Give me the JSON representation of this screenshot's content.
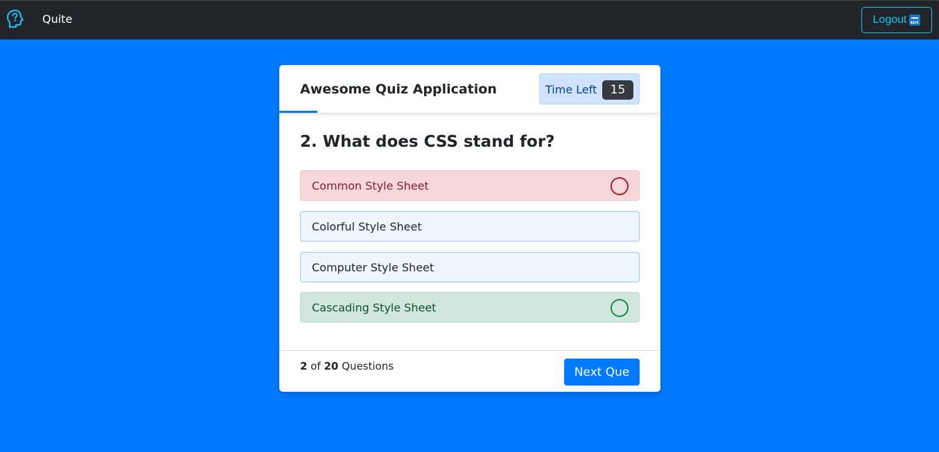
{
  "navbar": {
    "brand_icon": "head-question-icon",
    "brand_name": "Quite",
    "logout_label": "Logout",
    "logout_icon": "back-arrow-icon"
  },
  "quiz": {
    "title": "Awesome Quiz Application",
    "timer_label": "Time Left",
    "timer_value": "15",
    "progress": 0.1,
    "question": "2. What does CSS stand for?",
    "options": [
      {
        "label": "Common Style Sheet",
        "state": "wrong"
      },
      {
        "label": "Colorful Style Sheet",
        "state": "neutral"
      },
      {
        "label": "Computer Style Sheet",
        "state": "neutral"
      },
      {
        "label": "Cascading Style Sheet",
        "state": "correct"
      }
    ],
    "footer": {
      "current": "2",
      "of": "of",
      "total": "20",
      "questions_label": "Questions",
      "next_label": "Next Que"
    }
  },
  "colors": {
    "page_bg": "#007bff",
    "navbar_bg": "#212529",
    "logout_accent": "#0dcaf0",
    "wrong_bg": "#f8d7da",
    "correct_bg": "#d1e7dd"
  }
}
